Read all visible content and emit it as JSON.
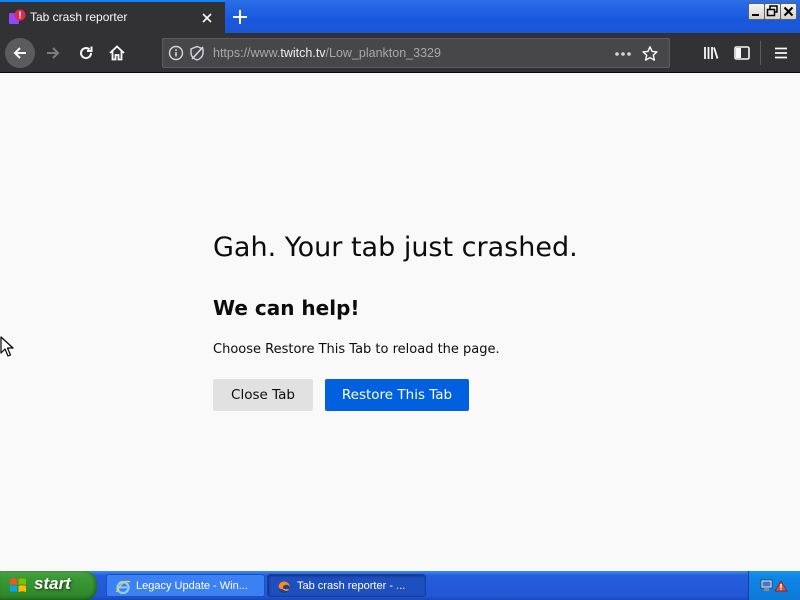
{
  "tab": {
    "title": "Tab crash reporter",
    "favicon": "crash-badge-icon"
  },
  "window_controls": [
    "minimize",
    "restore",
    "close"
  ],
  "toolbar": {
    "url_prefix": "https://www.",
    "url_domain": "twitch.tv",
    "url_path": "/Low_plankton_3329"
  },
  "page": {
    "title": "Gah. Your tab just crashed.",
    "help_heading": "We can help!",
    "help_text": "Choose Restore This Tab to reload the page.",
    "close_tab_label": "Close Tab",
    "restore_tab_label": "Restore This Tab"
  },
  "taskbar": {
    "start_label": "start",
    "tasks": [
      {
        "label": "Legacy Update - Win...",
        "icon": "internet-explorer-icon",
        "active": false
      },
      {
        "label": "Tab crash reporter - ...",
        "icon": "firefox-icon",
        "active": true
      }
    ]
  },
  "colors": {
    "accent": "#0060df",
    "toolbar": "#323234",
    "taskbar": "#245edb",
    "start": "#3c9a37"
  }
}
